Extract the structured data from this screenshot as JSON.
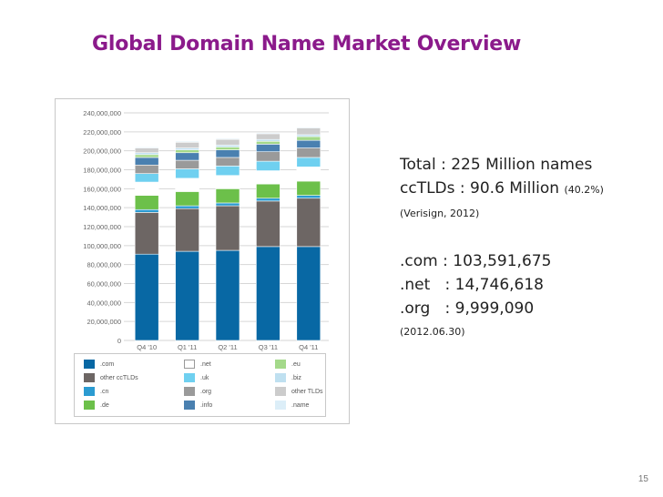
{
  "slide": {
    "title": "Global Domain Name Market Overview",
    "page_number": "15"
  },
  "info": {
    "total": "Total : 225 Million names",
    "cctlds_main": "ccTLDs : 90.6 Million",
    "cctlds_pct": "(40.2%)",
    "source": "(Verisign, 2012)",
    "com": ".com : 103,591,675",
    "net": ".net   : 14,746,618",
    "org": ".org   : 9,999,090",
    "date": "(2012.06.30)"
  },
  "chart_data": {
    "type": "bar",
    "stacked": true,
    "categories": [
      "Q4 '10",
      "Q1 '11",
      "Q2 '11",
      "Q3 '11",
      "Q4 '11"
    ],
    "y_ticks": [
      "0",
      "20,000,000",
      "40,000,000",
      "60,000,000",
      "80,000,000",
      "100,000,000",
      "120,000,000",
      "140,000,000",
      "160,000,000",
      "180,000,000",
      "200,000,000",
      "220,000,000",
      "240,000,000"
    ],
    "ylim": [
      0,
      240000000
    ],
    "grid": true,
    "legend_position": "bottom",
    "series": [
      {
        "name": ".com",
        "color": "#0868a4",
        "values": [
          91000000,
          94000000,
          95000000,
          99000000,
          99000000
        ]
      },
      {
        "name": "other ccTLDs",
        "color": "#6d6664",
        "values": [
          44000000,
          45000000,
          47000000,
          48000000,
          51000000
        ]
      },
      {
        "name": ".cn",
        "color": "#2b9bd1",
        "values": [
          3000000,
          3000000,
          3000000,
          3000000,
          3000000
        ]
      },
      {
        "name": ".de",
        "color": "#6cc04a",
        "values": [
          15000000,
          15000000,
          15000000,
          15000000,
          15000000
        ]
      },
      {
        "name": ".net",
        "color": "#ffffff",
        "values": [
          14000000,
          14000000,
          14000000,
          14000000,
          15000000
        ]
      },
      {
        "name": ".uk",
        "color": "#6fd0f0",
        "values": [
          9000000,
          10000000,
          10000000,
          10000000,
          10000000
        ]
      },
      {
        "name": ".org",
        "color": "#9a9a9a",
        "values": [
          9000000,
          9000000,
          9000000,
          10000000,
          10000000
        ]
      },
      {
        "name": ".info",
        "color": "#4a80b0",
        "values": [
          8000000,
          8000000,
          8000000,
          8000000,
          8000000
        ]
      },
      {
        "name": ".eu",
        "color": "#a4d98a",
        "values": [
          3000000,
          3000000,
          3000000,
          3000000,
          4000000
        ]
      },
      {
        "name": ".biz",
        "color": "#bfe0f0",
        "values": [
          2000000,
          2000000,
          2000000,
          2000000,
          2000000
        ]
      },
      {
        "name": "other TLDs",
        "color": "#cccccc",
        "values": [
          5000000,
          6000000,
          6000000,
          6000000,
          7000000
        ]
      },
      {
        "name": ".name",
        "color": "#dceef8",
        "values": [
          1000000,
          1000000,
          1000000,
          1000000,
          1000000
        ]
      }
    ],
    "legend_rows": [
      [
        ".com",
        ".net",
        ".eu"
      ],
      [
        "other ccTLDs",
        ".uk",
        ".biz"
      ],
      [
        ".cn",
        ".org",
        "other TLDs"
      ],
      [
        ".de",
        ".info",
        ".name"
      ]
    ]
  }
}
